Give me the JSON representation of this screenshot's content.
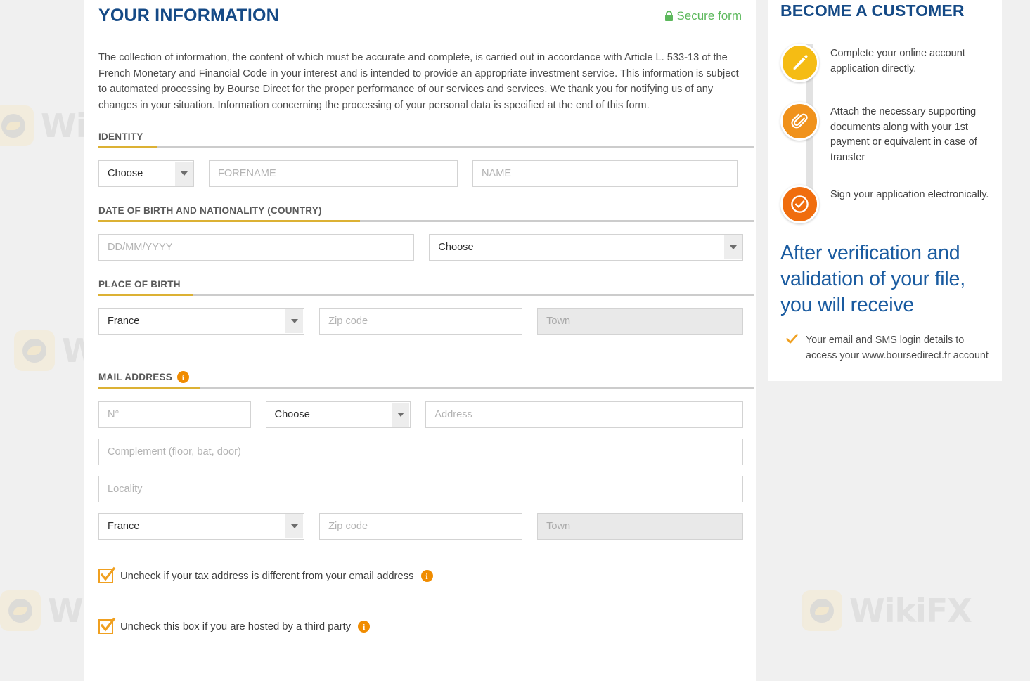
{
  "page": {
    "title": "YOUR INFORMATION",
    "secure_label": "Secure form",
    "intro": "The collection of information, the content of which must be accurate and complete, is carried out in accordance with Article L. 533-13 of the French Monetary and Financial Code in your interest and is intended to provide an appropriate investment service. This information is subject to automated processing by Bourse Direct for the proper performance of our services and services. We thank you for notifying us of any changes in your situation. Information concerning the processing of your personal data is specified at the end of this form."
  },
  "sections": {
    "identity": {
      "label": "IDENTITY",
      "civility_value": "Choose",
      "forename_placeholder": "FORENAME",
      "name_placeholder": "NAME"
    },
    "dob": {
      "label": "DATE OF BIRTH AND NATIONALITY (COUNTRY)",
      "date_placeholder": "DD/MM/YYYY",
      "nationality_value": "Choose"
    },
    "place_of_birth": {
      "label": "PLACE OF BIRTH",
      "country_value": "France",
      "zip_placeholder": "Zip code",
      "town_placeholder": "Town"
    },
    "mail_address": {
      "label": "MAIL ADDRESS",
      "number_placeholder": "N°",
      "street_type_value": "Choose",
      "address_placeholder": "Address",
      "complement_placeholder": "Complement (floor, bat, door)",
      "locality_placeholder": "Locality",
      "country_value": "France",
      "zip_placeholder": "Zip code",
      "town_placeholder": "Town"
    }
  },
  "checkboxes": [
    {
      "label": "Uncheck if your tax address is different from your email address",
      "checked": true
    },
    {
      "label": "Uncheck this box if you are hosted by a third party",
      "checked": true
    }
  ],
  "sidebar": {
    "title": "BECOME A CUSTOMER",
    "steps": [
      {
        "icon": "pencil-icon",
        "text": "Complete your online account application directly."
      },
      {
        "icon": "paperclip-icon",
        "text": "Attach the necessary supporting documents along with your 1st payment or equivalent in case of transfer"
      },
      {
        "icon": "check-circle-icon",
        "text": "Sign your application electronically."
      }
    ],
    "after_heading": "After verification and validation of your file, you will receive",
    "bullets": [
      "Your email and SMS login details to access your www.boursedirect.fr account"
    ]
  },
  "colors": {
    "brand_blue": "#154a86",
    "accent_gold": "#dcb134",
    "accent_orange": "#f08c00",
    "secure_green": "#5cb85c",
    "page_background": "#f0f0f0"
  },
  "watermark": {
    "text": "WikiFX"
  }
}
